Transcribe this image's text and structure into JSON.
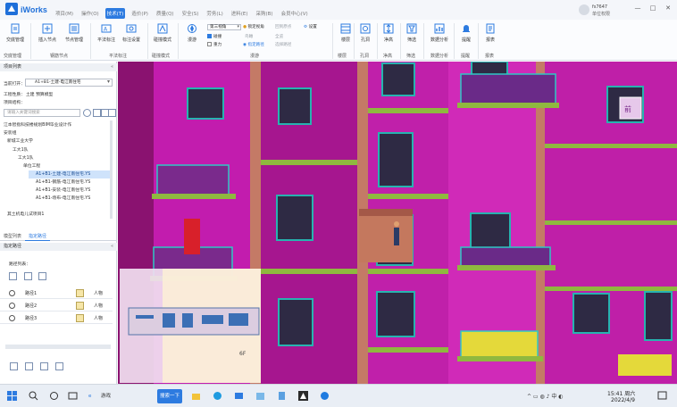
{
  "app": {
    "brand": "iWorks",
    "menus": [
      "项目(M)",
      "操作(O)",
      "技术(T)",
      "造价(P)",
      "质量(Q)",
      "安全(S)",
      "劳务(L)",
      "进料(E)",
      "采购(B)",
      "会员中心(V)"
    ],
    "active_menu_index": 2,
    "user_id": "fs7647",
    "user_role": "单位权限",
    "window_controls": [
      "—",
      "□",
      "✕"
    ]
  },
  "ribbon": {
    "buttons": [
      {
        "label": "交底管理"
      },
      {
        "label": "插入节点"
      },
      {
        "label": "节点管理"
      },
      {
        "label": "平法标注"
      },
      {
        "label": "标注设置"
      },
      {
        "label": "碰撞模式"
      },
      {
        "label": "漫游"
      },
      {
        "label": "视图"
      },
      {
        "label": "构件"
      },
      {
        "label": "楼层"
      },
      {
        "label": "孔洞"
      },
      {
        "label": "净高"
      },
      {
        "label": "筛选"
      },
      {
        "label": "数据分析"
      },
      {
        "label": "提醒"
      },
      {
        "label": "报表"
      }
    ],
    "groups": [
      "交底管理",
      "钢筋节点",
      "平法标注",
      "碰撞模式",
      "漫游",
      "楼层",
      "孔洞",
      "净高",
      "筛选",
      "数据分析",
      "提醒",
      "报表"
    ],
    "view_select": "第三视角",
    "options": {
      "gravity": "碰撞",
      "collision": "重力",
      "lock_view": "锁定视角",
      "bird_view": "鸟瞰",
      "specified_path": "指定路径",
      "return_origin": "回到原点",
      "preview": "全览",
      "select_path": "选择路径",
      "settings": "设置"
    }
  },
  "left_panel": {
    "project_list_title": "项目列表",
    "current_open_label": "当前打开：",
    "current_open_value": "A1+B1-土建-电江南住宅",
    "project_type_label": "工程性质：",
    "project_type_value": "土建 预算模型",
    "project_struct_label": "项目结构：",
    "search_placeholder": "请输入关键词搜索",
    "tree": [
      "江本智指科技楼规划BIM毕业设计作",
      "安装组",
      "新城工业大学",
      "工大1队",
      "工大1队",
      "单位工程",
      "A1+B1-土建-电江南住宅.YS",
      "A1+B1-钢筋-电江南住宅.YS",
      "A1+B1-安装-电江南住宅.YS",
      "A1+B1-场布-电江南住宅.YS",
      "其土机电儿试项目1"
    ],
    "tabs": [
      "模型列表",
      "指定路径"
    ],
    "path_section_title": "指定路径",
    "path_list_label": "路径列表：",
    "paths": [
      {
        "name": "路径1",
        "type": "人物"
      },
      {
        "name": "路径2",
        "type": "人物"
      },
      {
        "name": "路径3",
        "type": "人物"
      }
    ],
    "collapse_glyph": "«"
  },
  "viewport": {
    "floor_label": "6F",
    "corner_glyph": "前"
  },
  "taskbar": {
    "search_text": "游戏",
    "search_button": "搜索一下",
    "time": "15:41 周六",
    "date": "2022/4/9"
  }
}
